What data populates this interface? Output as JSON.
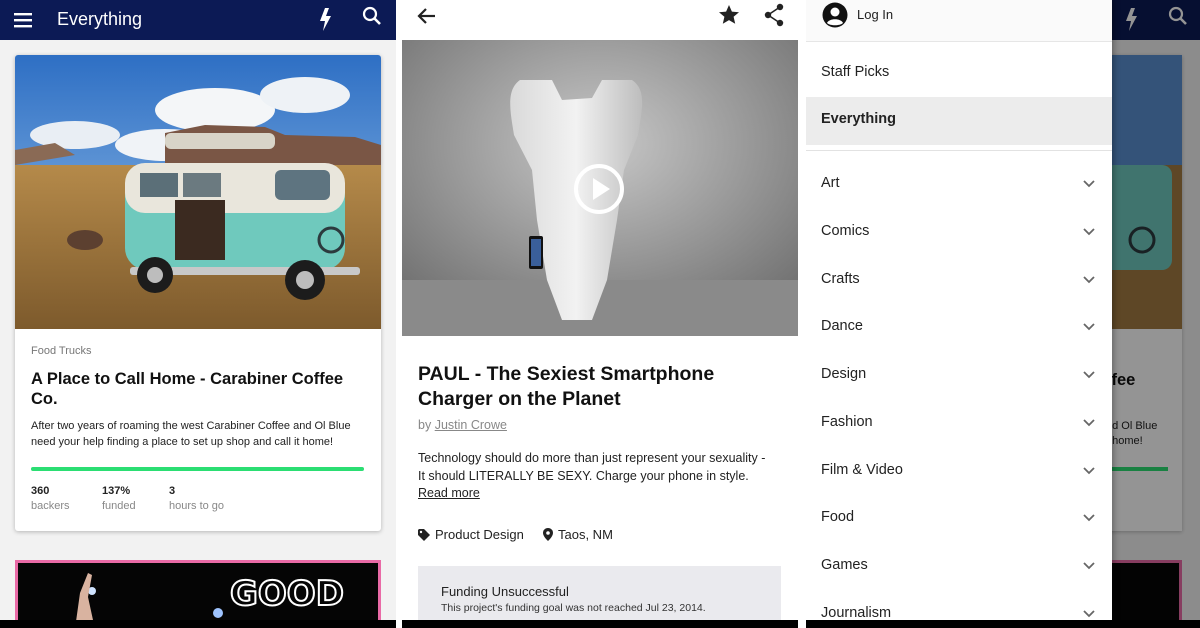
{
  "feed": {
    "title": "Everything",
    "card": {
      "category": "Food Trucks",
      "title": "A Place to Call Home - Carabiner Coffee Co.",
      "blurb": "After two years of roaming the west Carabiner Coffee and Ol Blue need your help finding a place to set up shop and call it home!",
      "progress": 1.0,
      "stats": [
        {
          "value": "360",
          "label": "backers"
        },
        {
          "value": "137%",
          "label": "funded"
        },
        {
          "value": "3",
          "label": "hours to go"
        }
      ]
    }
  },
  "project": {
    "title": "PAUL - The Sexiest Smartphone Charger on the Planet",
    "by_prefix": "by",
    "creator": "Justin Crowe",
    "description": "Technology should do more than just represent your sexuality - It should LITERALLY BE SEXY. Charge your phone in style.",
    "read_more": "Read more",
    "category": "Product Design",
    "location": "Taos, NM",
    "funding_status": "Funding Unsuccessful",
    "funding_detail": "This project's funding goal was not reached Jul 23, 2014."
  },
  "drawer": {
    "login": "Log In",
    "top_items": [
      "Staff Picks",
      "Everything"
    ],
    "active": "Everything",
    "categories": [
      "Art",
      "Comics",
      "Crafts",
      "Dance",
      "Design",
      "Fashion",
      "Film & Video",
      "Food",
      "Games",
      "Journalism"
    ]
  },
  "background_peek": {
    "title_fragment": "ffee",
    "blurb_line1": "nd Ol Blue",
    "blurb_line2": "t home!"
  },
  "colors": {
    "appbar": "#0c1a55",
    "progress": "#2bde73",
    "card_border": "#e96aa6"
  },
  "icons": [
    "menu-icon",
    "bolt-icon",
    "search-icon",
    "back-arrow-icon",
    "star-icon",
    "share-icon",
    "play-icon",
    "tag-icon",
    "location-pin-icon",
    "account-icon",
    "chevron-down-icon"
  ]
}
